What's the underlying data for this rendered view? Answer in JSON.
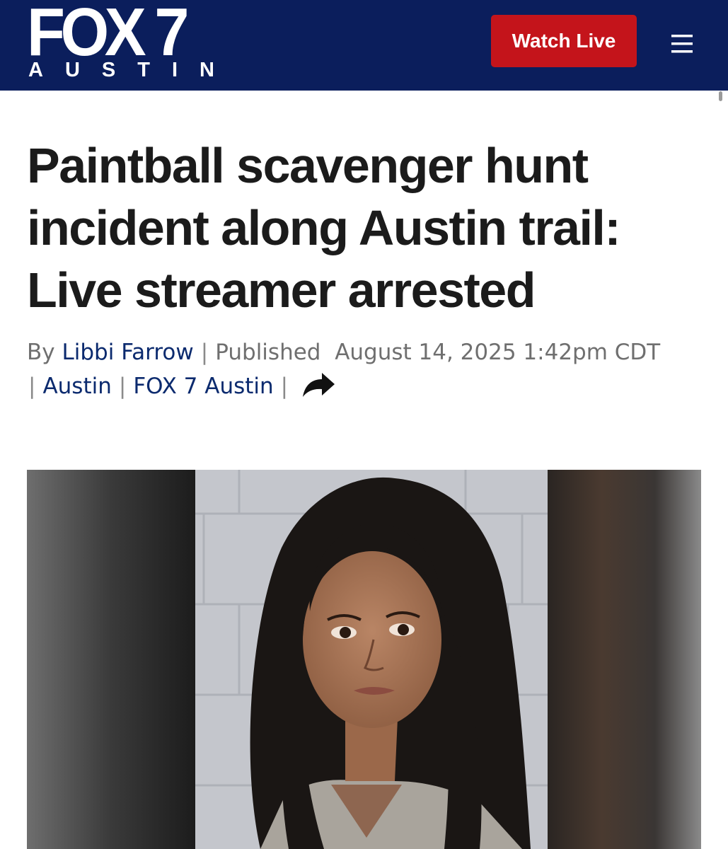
{
  "header": {
    "logo_main": "FOX 7",
    "logo_sub": "AUSTIN",
    "watch_live_label": "Watch Live",
    "menu_icon": "hamburger-menu-icon",
    "background_color": "#0b1e5c",
    "accent_color": "#c4141b"
  },
  "article": {
    "headline": "Paintball scavenger hunt incident along Austin trail: Live streamer arrested",
    "byline": {
      "by_label": "By",
      "author": "Libbi Farrow",
      "published_label": "Published",
      "published_date": "August 14, 2025 1:42pm CDT",
      "location": "Austin",
      "source": "FOX 7 Austin",
      "share_icon": "share-arrow-icon"
    },
    "hero_image": {
      "type": "mugshot-photo"
    }
  }
}
